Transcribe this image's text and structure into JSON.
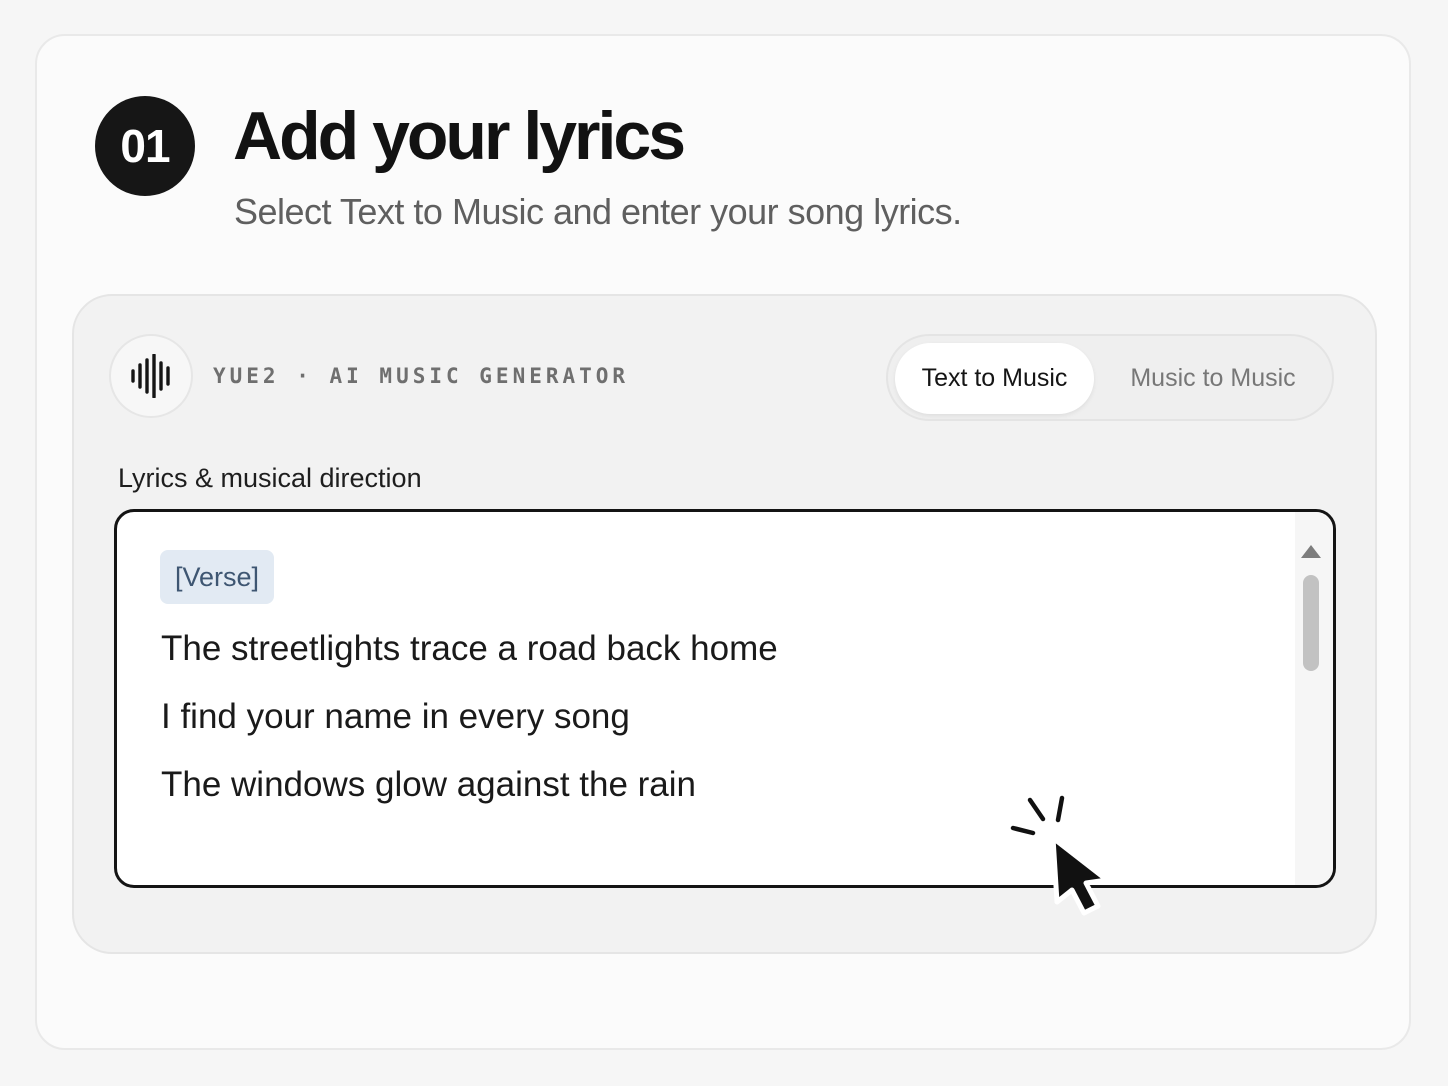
{
  "step": {
    "number": "01",
    "title": "Add your lyrics",
    "subtitle": "Select Text to Music and enter your song lyrics."
  },
  "app": {
    "brand": "YUE2 · AI MUSIC GENERATOR",
    "logo_icon": "waveform-icon"
  },
  "mode_toggle": {
    "options": [
      "Text to Music",
      "Music to Music"
    ],
    "selected": "Text to Music"
  },
  "lyrics_field": {
    "label": "Lyrics & musical direction",
    "section_tag": "[Verse]",
    "lines": [
      "The streetlights trace a road back home",
      "I find your name in every song",
      "The windows glow against the rain"
    ]
  },
  "colors": {
    "badge": "#161616",
    "tag_background": "#e2eaf3",
    "tag_text": "#3e5672",
    "field_border": "#141414"
  }
}
